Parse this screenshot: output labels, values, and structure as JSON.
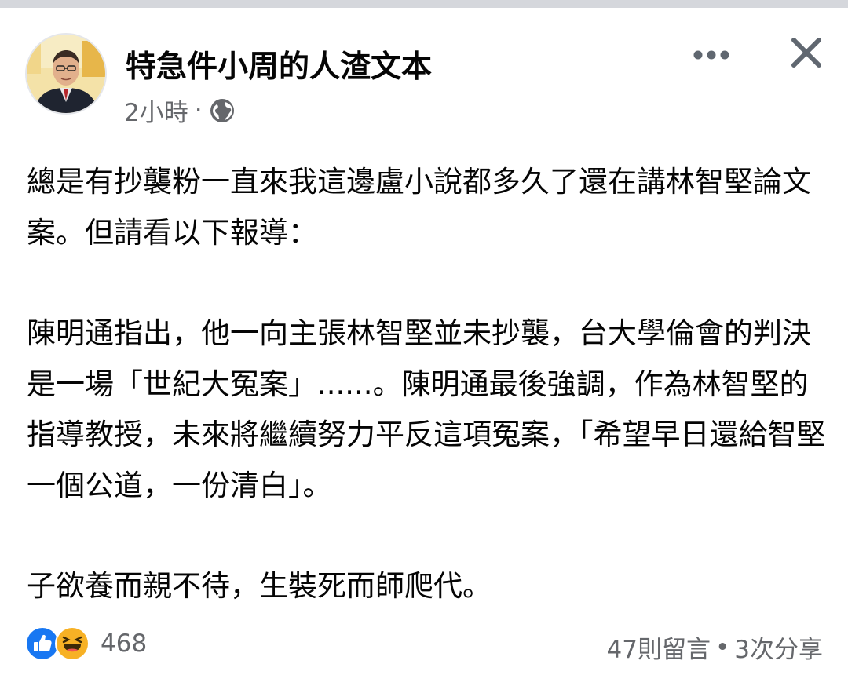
{
  "post": {
    "page_name": "特急件小周的人渣文本",
    "time": "2小時",
    "separator": "·",
    "privacy_icon": "globe-icon",
    "paragraphs": [
      "總是有抄襲粉一直來我這邊盧小說都多久了還在講林智堅論文案。但請看以下報導：",
      "陳明通指出，他一向主張林智堅並未抄襲，台大學倫會的判決是一場「世紀大冤案」......。陳明通最後強調，作為林智堅的指導教授，未來將繼續努力平反這項冤案，「希望早日還給智堅一個公道，一份清白」。",
      "子欲養而親不待，生裝死而師爬代。"
    ]
  },
  "footer": {
    "reaction_icons": [
      "like-icon",
      "haha-icon"
    ],
    "reaction_count": "468",
    "comments": "47則留言",
    "dot": "•",
    "shares": "3次分享"
  },
  "colors": {
    "like_blue": "#1877f2",
    "haha_yellow": "#f7b125",
    "secondary_text": "#65676b",
    "icon_gray": "#606770"
  }
}
